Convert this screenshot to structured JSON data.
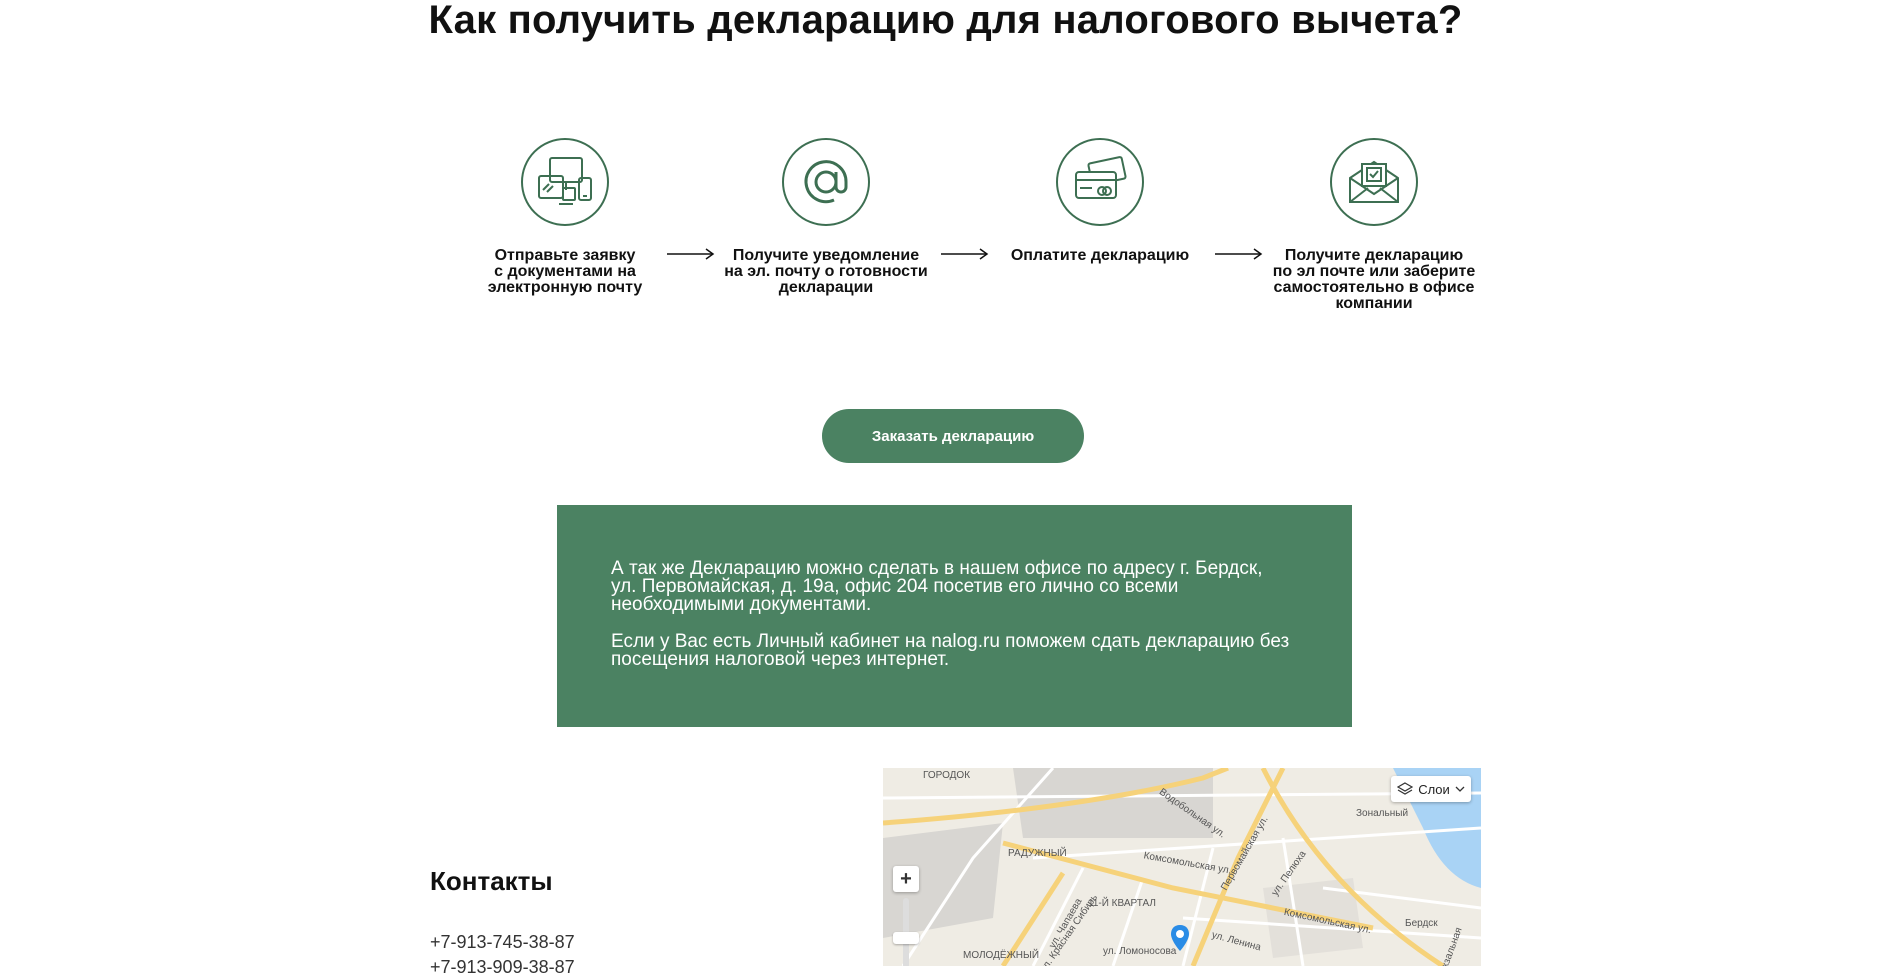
{
  "heading": "Как получить декларацию для налогового вычета?",
  "steps": [
    {
      "icon": "devices-icon",
      "lines": [
        "Отправьте заявку",
        "с документами на",
        "электронную почту"
      ]
    },
    {
      "icon": "at-sign-icon",
      "lines": [
        "Получите уведомление",
        "на эл. почту о готовности",
        "декларации"
      ]
    },
    {
      "icon": "credit-card-icon",
      "lines": [
        "Оплатите декларацию"
      ]
    },
    {
      "icon": "envelope-check-icon",
      "lines": [
        "Получите декларацию",
        "по эл почте или заберите",
        "самостоятельно в офисе",
        "компании"
      ]
    }
  ],
  "order_button": "Заказать декларацию",
  "info_box": {
    "paragraph1_lines": [
      "А так же Декларацию можно сделать в нашем офисе по адресу г. Бердск,",
      "ул. Первомайская, д. 19а, офис 204 посетив его лично со всеми",
      "необходимыми документами."
    ],
    "paragraph2_lines": [
      "Если у Вас есть Личный кабинет на nalog.ru поможем сдать декларацию без",
      "посещения налоговой через интернет."
    ]
  },
  "contacts": {
    "title": "Контакты",
    "phones": [
      "+7-913-745-38-87",
      "+7-913-909-38-87"
    ]
  },
  "map": {
    "layers_label": "Слои",
    "zoom_in": "+",
    "labels": [
      "ГОРОДОК",
      "РАДУЖНЫЙ",
      "11-Й КВАРТАЛ",
      "МОЛОДЁЖНЫЙ",
      "Зональный",
      "Бердск",
      "Комсомольская ул.",
      "Первомайская ул.",
      "ул. Красная Сибирь",
      "ул. Ленина",
      "ул. Ломоносова",
      "Вокзальная",
      "ул. Пелюха",
      "Водобольная ул.",
      "ул. Чапаева",
      "Комсомольская ул."
    ],
    "colors": {
      "land": "#efece4",
      "water": "#a9d3f5",
      "major_road": "#f6d27a",
      "minor_road": "#ffffff",
      "block": "#d8d6d2",
      "pin": "#2a8ce6"
    }
  },
  "colors": {
    "brand_green": "#4b8262",
    "icon_green": "#3d6f52"
  }
}
